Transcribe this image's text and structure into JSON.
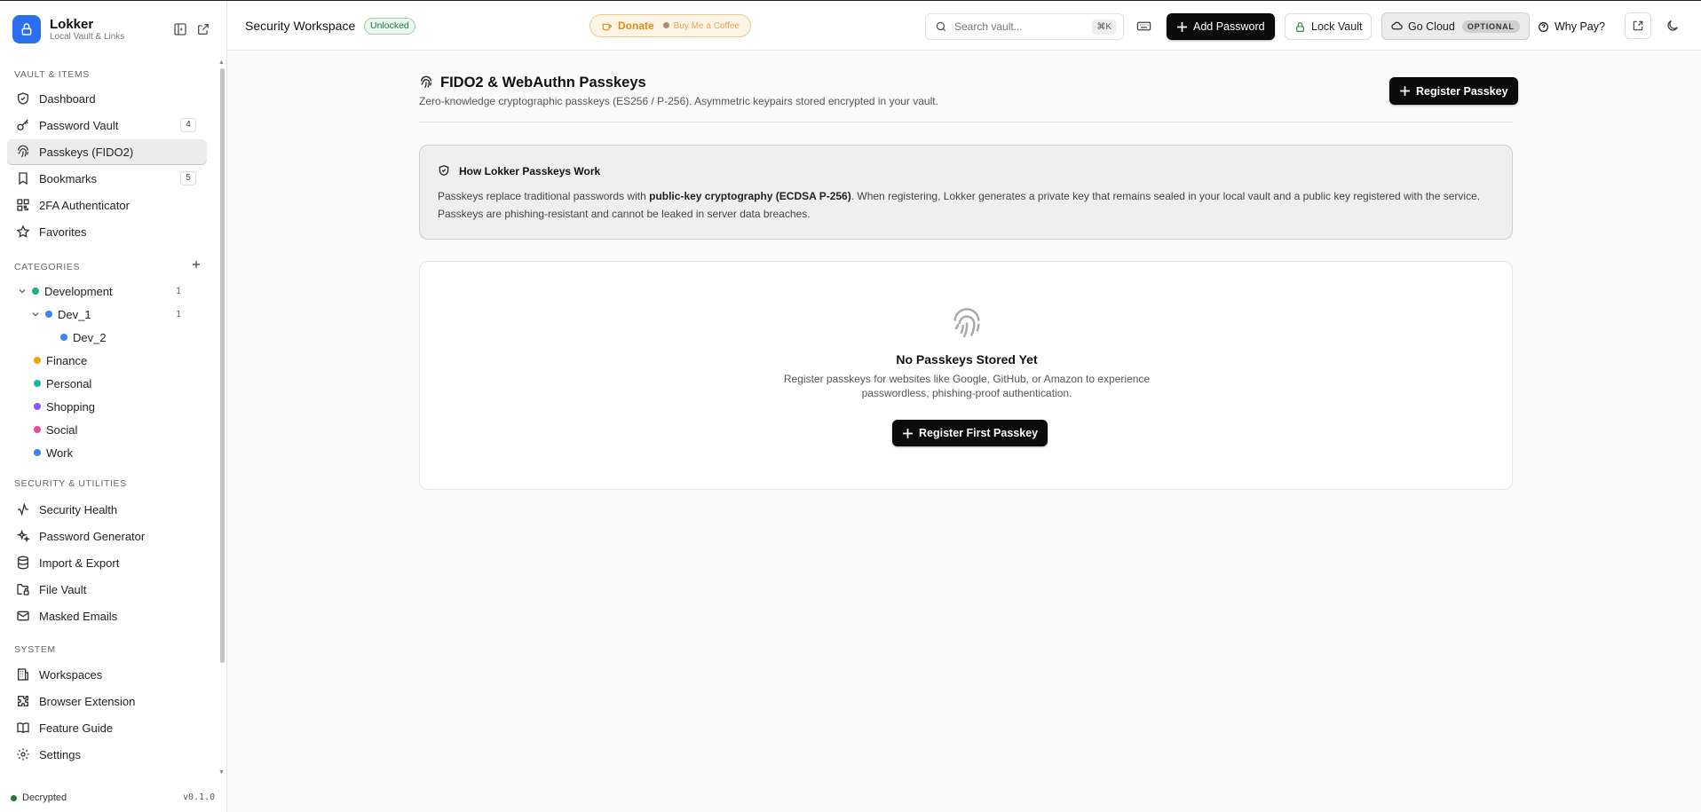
{
  "brand": {
    "title": "Lokker",
    "subtitle": "Local Vault & Links"
  },
  "sidebar": {
    "sections": {
      "vault": "VAULT & ITEMS",
      "categories": "CATEGORIES",
      "security": "SECURITY & UTILITIES",
      "system": "SYSTEM"
    },
    "vault_items": [
      {
        "label": "Dashboard",
        "icon": "shield-check-icon"
      },
      {
        "label": "Password Vault",
        "icon": "key-icon",
        "badge": "4"
      },
      {
        "label": "Passkeys (FIDO2)",
        "icon": "fingerprint-icon",
        "active": true
      },
      {
        "label": "Bookmarks",
        "icon": "bookmark-icon",
        "badge": "5"
      },
      {
        "label": "2FA Authenticator",
        "icon": "qr-icon"
      },
      {
        "label": "Favorites",
        "icon": "star-icon"
      }
    ],
    "categories": [
      {
        "label": "Development",
        "color": "#22b07d",
        "count": "1",
        "level": 0,
        "expanded": true
      },
      {
        "label": "Dev_1",
        "color": "#3b82f6",
        "count": "1",
        "level": 1,
        "expanded": true
      },
      {
        "label": "Dev_2",
        "color": "#3b82f6",
        "level": 2
      },
      {
        "label": "Finance",
        "color": "#f59e0b",
        "level": 0
      },
      {
        "label": "Personal",
        "color": "#14b8a6",
        "level": 0
      },
      {
        "label": "Shopping",
        "color": "#8b5cf6",
        "level": 0
      },
      {
        "label": "Social",
        "color": "#ec4899",
        "level": 0
      },
      {
        "label": "Work",
        "color": "#3b82f6",
        "level": 0
      }
    ],
    "security_items": [
      {
        "label": "Security Health",
        "icon": "activity-icon"
      },
      {
        "label": "Password Generator",
        "icon": "sparkles-icon"
      },
      {
        "label": "Import & Export",
        "icon": "database-icon"
      },
      {
        "label": "File Vault",
        "icon": "folder-lock-icon"
      },
      {
        "label": "Masked Emails",
        "icon": "mail-icon"
      }
    ],
    "system_items": [
      {
        "label": "Workspaces",
        "icon": "building-icon"
      },
      {
        "label": "Browser Extension",
        "icon": "puzzle-icon"
      },
      {
        "label": "Feature Guide",
        "icon": "book-icon"
      },
      {
        "label": "Settings",
        "icon": "gear-icon"
      }
    ],
    "status": "Decrypted",
    "version": "v0.1.0"
  },
  "header": {
    "workspace": "Security Workspace",
    "workspace_status": "Unlocked",
    "donate": "Donate",
    "buy_coffee": "Buy Me a Coffee",
    "search_placeholder": "Search vault...",
    "search_shortcut": "⌘K",
    "add_password": "Add Password",
    "lock_vault": "Lock Vault",
    "go_cloud": "Go Cloud",
    "optional": "OPTIONAL",
    "why_pay": "Why Pay?"
  },
  "main": {
    "title": "FIDO2 & WebAuthn Passkeys",
    "subtitle": "Zero-knowledge cryptographic passkeys (ES256 / P-256). Asymmetric keypairs stored encrypted in your vault.",
    "register_button": "Register Passkey",
    "info": {
      "title": "How Lokker Passkeys Work",
      "body_prefix": "Passkeys replace traditional passwords with ",
      "body_bold": "public-key cryptography (ECDSA P-256)",
      "body_suffix": ". When registering, Lokker generates a private key that remains sealed in your local vault and a public key registered with the service. Passkeys are phishing-resistant and cannot be leaked in server data breaches."
    },
    "empty": {
      "title": "No Passkeys Stored Yet",
      "text": "Register passkeys for websites like Google, GitHub, or Amazon to experience passwordless, phishing-proof authentication.",
      "button": "Register First Passkey"
    }
  }
}
